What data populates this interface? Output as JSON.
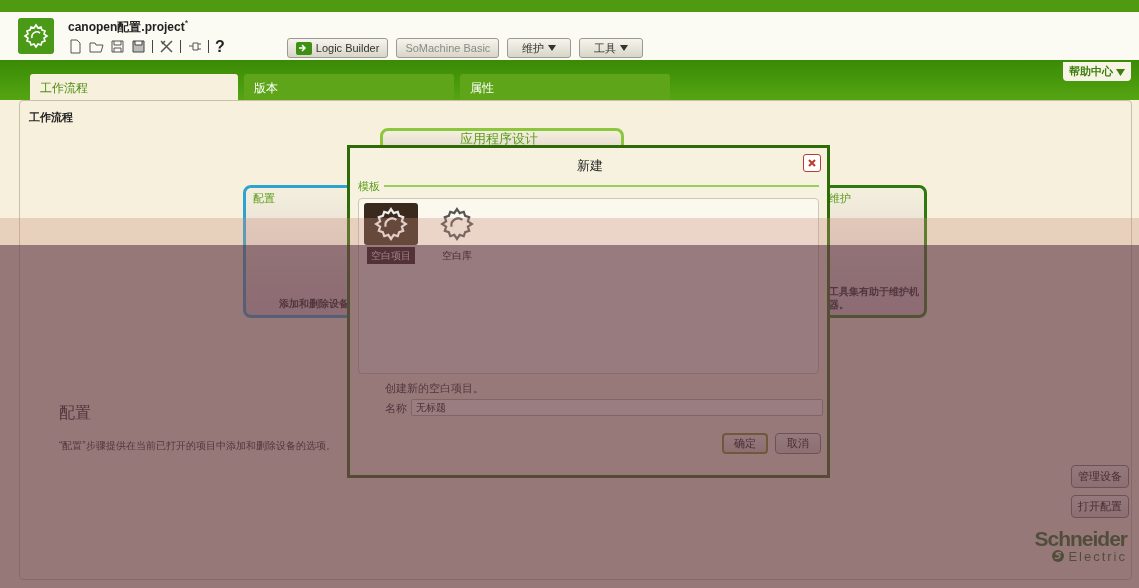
{
  "window": {
    "title": "canopen配置.project",
    "modified_mark": "*"
  },
  "toolbar": {
    "help": "?",
    "buttons": [
      {
        "label": "Logic Builder",
        "disabled": false,
        "dropdown": false,
        "kind": "launch"
      },
      {
        "label": "SoMachine Basic",
        "disabled": true,
        "dropdown": false,
        "kind": "plain"
      },
      {
        "label": "维护",
        "disabled": false,
        "dropdown": true,
        "kind": "plain"
      },
      {
        "label": "工具",
        "disabled": false,
        "dropdown": true,
        "kind": "plain"
      }
    ]
  },
  "help_center": "帮助中心",
  "tabs": [
    {
      "label": "工作流程",
      "selected": true
    },
    {
      "label": "版本",
      "selected": false
    },
    {
      "label": "属性",
      "selected": false
    }
  ],
  "workflow": {
    "title": "工作流程",
    "steps": [
      {
        "label": "应用程序设计",
        "kind": "top",
        "color": "#8cc63f"
      },
      {
        "label": "配置",
        "description": "添加和删除设备",
        "kind": "left",
        "color": "#2fa3cf"
      },
      {
        "label": "维护",
        "description": "工具集有助于维护机器。",
        "kind": "right",
        "color": "#2b7a0b"
      }
    ]
  },
  "details": {
    "title": "配置",
    "text": "“配置”步骤提供在当前已打开的项目中添加和删除设备的选项。",
    "actions": [
      "管理设备",
      "打开配置"
    ]
  },
  "logo": {
    "line1": "Schneider",
    "line2": "Electric"
  },
  "dialog": {
    "title": "新建",
    "section": "模板",
    "templates": [
      {
        "label": "空白项目",
        "selected": true
      },
      {
        "label": "空白库",
        "selected": false
      }
    ],
    "description": "创建新的空白项目。",
    "name_label": "名称",
    "name_value": "无标题",
    "buttons": [
      {
        "label": "确定",
        "default": true
      },
      {
        "label": "取消",
        "default": false
      }
    ]
  }
}
